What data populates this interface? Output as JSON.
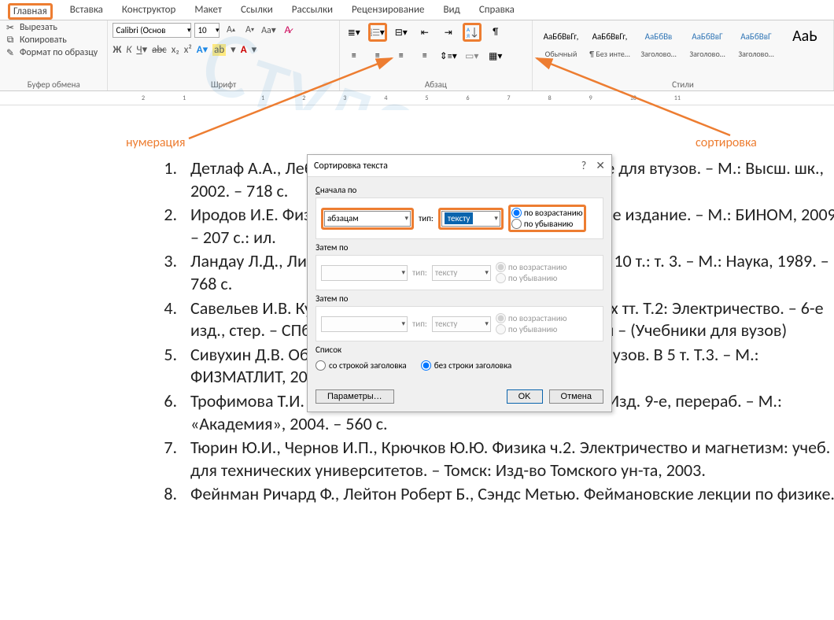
{
  "tabs": {
    "home": "Главная",
    "insert": "Вставка",
    "design": "Конструктор",
    "layout": "Макет",
    "references": "Ссылки",
    "mailings": "Рассылки",
    "review": "Рецензирование",
    "view": "Вид",
    "help": "Справка"
  },
  "clipboard": {
    "cut": "Вырезать",
    "copy": "Копировать",
    "format_painter": "Формат по образцу",
    "group": "Буфер обмена"
  },
  "font": {
    "name": "Calibri (Основ",
    "size": "10",
    "group": "Шрифт"
  },
  "paragraph": {
    "group": "Абзац"
  },
  "styles": {
    "group": "Стили",
    "normal": {
      "preview": "АаБбВвГг,",
      "label": "Обычный"
    },
    "nospace": {
      "preview": "АаБбВвГг,",
      "label": "¶ Без инте…"
    },
    "heading1": {
      "preview": "АаБбВв",
      "label": "Заголово…"
    },
    "heading2": {
      "preview": "АаБбВвГ",
      "label": "Заголово…"
    },
    "heading3": {
      "preview": "АаБбВвГ",
      "label": "Заголово…"
    },
    "title": {
      "preview": "АаЬ",
      "label": ""
    }
  },
  "annotations": {
    "numbering": "нумерация",
    "sorting": "сортировка"
  },
  "watermark": "Студсервис сервис для студентов",
  "dialog": {
    "title": "Сортировка текста",
    "first_by": "Сначала по",
    "then_by": "Затем по",
    "type": "тип:",
    "field1": "абзацам",
    "ftype1": "тексту",
    "ftype23": "тексту",
    "asc": "по возрастанию",
    "desc": "по убыванию",
    "list": "Список",
    "with_header": "со строкой заголовка",
    "no_header": "без строки заголовка",
    "options": "Параметры…",
    "ok": "OK",
    "cancel": "Отмена"
  },
  "list": [
    "Детлаф А.А., Лебедев А.В. Курс физики : учебное пособие для втузов. – М.: Высш. шк., 2002. – 718 с.",
    "Иродов И.Е. Физика макросистем. Основные законы. – 5-е издание. – М.: БИНОМ, 2009. – 207 с.: ил.",
    "Ландау Л.Д., Лифшиц Е.М. Теоретический курс физики: В 10 т.: т. 3. – М.: Наука, 1989. – 768 с.",
    "Савельев И.В. Курс общей физики: учебное пособие. В 3-х тт. Т.2: Электричество. – 6-е изд., стер. – СПб.: Издательство «Лань», 2007. – 496 с.: ил – (Учебники для вузов)",
    "Сивухин Д.В. Общий курс физики: учебное пособие для вузов. В 5 т. Т.3. – М.: ФИЗМАТЛИТ, 2006. – 656 с.",
    "Трофимова Т.И. Курс физики: учеб. пособие для вузов. – Изд. 9-е, перераб. – М.: «Академия», 2004. – 560 с.",
    "Тюрин Ю.И., Чернов И.П., Крючков Ю.Ю. Физика ч.2. Электричество и магнетизм: учеб. для технических университетов. – Томск: Изд-во Томского ун-та, 2003.",
    "Фейнман Ричард Ф., Лейтон Роберт Б., Сэндс Метью. Феймановские лекции по физике."
  ]
}
